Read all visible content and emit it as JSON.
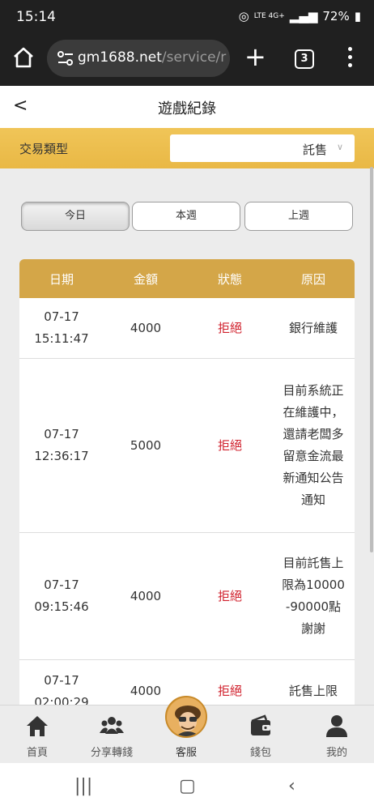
{
  "status_bar": {
    "time": "15:14",
    "network": "LTE 4G+",
    "battery": "72%"
  },
  "browser": {
    "url_host": "gm1688.net",
    "url_path": "/service/r",
    "tab_count": "3"
  },
  "page": {
    "back_label": "<",
    "title": "遊戲紀錄"
  },
  "filter": {
    "label": "交易類型",
    "selected": "託售"
  },
  "period_tabs": [
    {
      "label": "今日",
      "active": true
    },
    {
      "label": "本週",
      "active": false
    },
    {
      "label": "上週",
      "active": false
    }
  ],
  "table": {
    "headers": [
      "日期",
      "金額",
      "狀態",
      "原因"
    ],
    "rows": [
      {
        "date": "07-17",
        "time": "15:11:47",
        "amount": "4000",
        "status": "拒絕",
        "reason": "銀行維護"
      },
      {
        "date": "07-17",
        "time": "12:36:17",
        "amount": "5000",
        "status": "拒絕",
        "reason": "目前系統正在維護中，還請老闆多留意金流最新通知公告通知"
      },
      {
        "date": "07-17",
        "time": "09:15:46",
        "amount": "4000",
        "status": "拒絕",
        "reason": "目前託售上限為10000-90000點謝謝"
      },
      {
        "date": "07-17",
        "time": "02:00:29",
        "amount": "4000",
        "status": "拒絕",
        "reason": "託售上限"
      }
    ]
  },
  "bottom_nav": [
    {
      "label": "首頁",
      "icon": "home-icon"
    },
    {
      "label": "分享轉錢",
      "icon": "users-icon"
    },
    {
      "label": "客服",
      "icon": "support-avatar"
    },
    {
      "label": "錢包",
      "icon": "wallet-icon"
    },
    {
      "label": "我的",
      "icon": "user-icon"
    }
  ],
  "colors": {
    "accent": "#e9b845",
    "header_gold": "#d4a648",
    "reject_red": "#d0202c"
  }
}
